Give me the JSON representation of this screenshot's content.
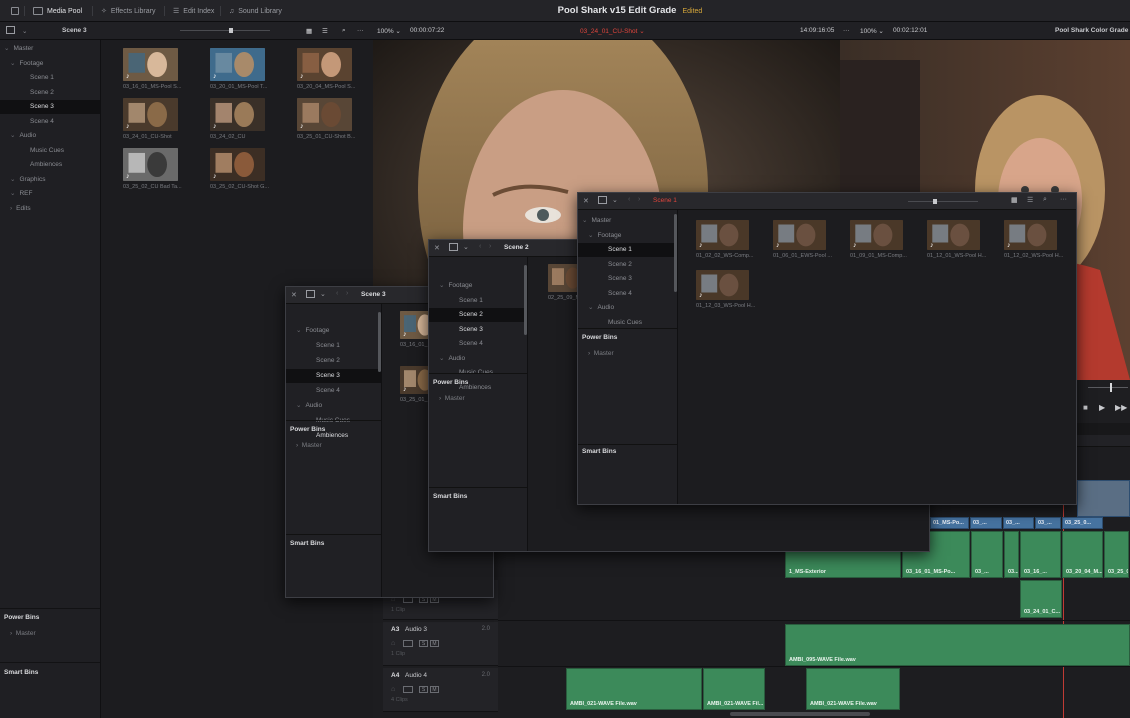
{
  "topbar": {
    "tabs": [
      {
        "label": "Media Pool",
        "icon": "media-pool-icon",
        "active": true
      },
      {
        "label": "Effects Library",
        "icon": "effects-icon",
        "active": false
      },
      {
        "label": "Edit Index",
        "icon": "edit-index-icon",
        "active": false
      },
      {
        "label": "Sound Library",
        "icon": "sound-library-icon",
        "active": false
      }
    ],
    "title": "Pool Shark v15 Edit Grade",
    "status": "Edited"
  },
  "subbar": {
    "bin_name": "Scene 3",
    "zoom_left": "100%",
    "timecode_left": "00:00:07:22",
    "clip_name": "03_24_01_CU-Shot",
    "timecode_mid": "14:09:16:05",
    "zoom_right": "100%",
    "timecode_right": "00:02:12:01",
    "timeline_name": "Pool Shark Color Grade"
  },
  "main_pool": {
    "tree": [
      {
        "label": "Master",
        "level": 0
      },
      {
        "label": "Footage",
        "level": 1
      },
      {
        "label": "Scene 1",
        "level": 2
      },
      {
        "label": "Scene 2",
        "level": 2
      },
      {
        "label": "Scene 3",
        "level": 2,
        "selected": true
      },
      {
        "label": "Scene 4",
        "level": 2
      },
      {
        "label": "Audio",
        "level": 1
      },
      {
        "label": "Music Cues",
        "level": 2
      },
      {
        "label": "Ambiences",
        "level": 2
      },
      {
        "label": "Graphics",
        "level": 1
      },
      {
        "label": "REF",
        "level": 1
      },
      {
        "label": "Edits",
        "level": 1
      }
    ],
    "power_bins": "Power Bins",
    "power_master": "Master",
    "smart_bins": "Smart Bins",
    "clips": [
      {
        "label": "03_16_01_MS-Pool S..."
      },
      {
        "label": "03_20_01_MS-Pool T..."
      },
      {
        "label": "03_20_04_MS-Pool S..."
      },
      {
        "label": "03_24_01_CU-Shot"
      },
      {
        "label": "03_24_02_CU"
      },
      {
        "label": "03_25_01_CU-Shot B..."
      },
      {
        "label": "03_25_02_CU Bad Ta..."
      },
      {
        "label": "03_25_02_CU-Shot G..."
      }
    ]
  },
  "window_scene3": {
    "title": "Scene 3",
    "tree": [
      {
        "label": "Footage",
        "level": 1
      },
      {
        "label": "Scene 1",
        "level": 2
      },
      {
        "label": "Scene 2",
        "level": 2
      },
      {
        "label": "Scene 3",
        "level": 2,
        "selected": true
      },
      {
        "label": "Scene 4",
        "level": 2
      },
      {
        "label": "Audio",
        "level": 1
      },
      {
        "label": "Music Cues",
        "level": 2
      },
      {
        "label": "Ambiences",
        "level": 2,
        "bright": true
      }
    ],
    "power_bins": "Power Bins",
    "power_master": "Master",
    "smart_bins": "Smart Bins",
    "clips": [
      {
        "label": "03_16_01_..."
      },
      {
        "label": "03_25_01_..."
      }
    ]
  },
  "window_scene2": {
    "title": "Scene 2",
    "tree": [
      {
        "label": "Footage",
        "level": 1
      },
      {
        "label": "Scene 1",
        "level": 2
      },
      {
        "label": "Scene 2",
        "level": 2,
        "selected": true
      },
      {
        "label": "Scene 3",
        "level": 2,
        "bright": true
      },
      {
        "label": "Scene 4",
        "level": 2
      },
      {
        "label": "Audio",
        "level": 1
      },
      {
        "label": "Music Cues",
        "level": 2
      },
      {
        "label": "Ambiences",
        "level": 2
      }
    ],
    "power_bins": "Power Bins",
    "power_master": "Master",
    "smart_bins": "Smart Bins",
    "clips": [
      {
        "label": "02_25_09_M..."
      }
    ]
  },
  "window_scene1": {
    "title": "Scene 1",
    "tree": [
      {
        "label": "Master",
        "level": 0
      },
      {
        "label": "Footage",
        "level": 1
      },
      {
        "label": "Scene 1",
        "level": 2,
        "selected": true
      },
      {
        "label": "Scene 2",
        "level": 2
      },
      {
        "label": "Scene 3",
        "level": 2
      },
      {
        "label": "Scene 4",
        "level": 2
      },
      {
        "label": "Audio",
        "level": 1
      },
      {
        "label": "Music Cues",
        "level": 2
      }
    ],
    "power_bins": "Power Bins",
    "power_master": "Master",
    "smart_bins": "Smart Bins",
    "clips": [
      {
        "label": "01_02_02_WS-Comp..."
      },
      {
        "label": "01_06_01_EWS-Pool ..."
      },
      {
        "label": "01_09_01_MS-Comp..."
      },
      {
        "label": "01_12_01_WS-Pool H..."
      },
      {
        "label": "01_12_02_WS-Pool H..."
      },
      {
        "label": "01_12_03_WS-Pool H..."
      }
    ]
  },
  "timeline": {
    "tracks": [
      {
        "id": "",
        "name": "",
        "count": "1 Clip"
      },
      {
        "id": "A3",
        "name": "Audio 3",
        "level": "2.0",
        "count": "1 Clip"
      },
      {
        "id": "A4",
        "name": "Audio 4",
        "level": "2.0",
        "count": "4 Clips"
      }
    ],
    "track_buttons": [
      "S",
      "M"
    ],
    "video_clips": [
      {
        "label": "01_MS-Po..."
      },
      {
        "label": "03_..."
      },
      {
        "label": "03_..."
      },
      {
        "label": "03_..."
      },
      {
        "label": "03_25_0..."
      }
    ],
    "a1_clips": [
      {
        "label": "1_MS-Exterior"
      },
      {
        "label": "03_16_01_MS-Po..."
      },
      {
        "label": "03_..."
      },
      {
        "label": "03..."
      },
      {
        "label": "03_16_..."
      },
      {
        "label": "03_20_04_M..."
      },
      {
        "label": "03_25_0..."
      }
    ],
    "a2_clip": "03_24_01_C...",
    "a3_clip": "AMBI_095-WAVE File.wav",
    "a4_clips": [
      {
        "label": "AMBI_021-WAVE File.wav"
      },
      {
        "label": "AMBI_021-WAVE Fil..."
      },
      {
        "label": "AMBI_021-WAVE File.wav"
      }
    ]
  }
}
